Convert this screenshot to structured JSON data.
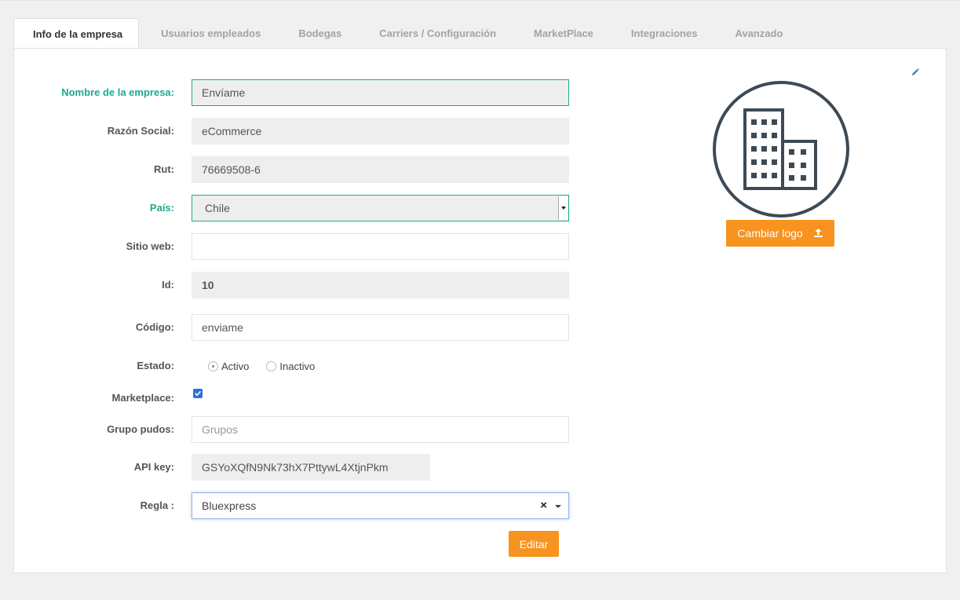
{
  "tabs": [
    {
      "label": "Info de la empresa",
      "active": true
    },
    {
      "label": "Usuarios empleados"
    },
    {
      "label": "Bodegas"
    },
    {
      "label": "Carriers / Configuración"
    },
    {
      "label": "MarketPlace"
    },
    {
      "label": "Integraciones"
    },
    {
      "label": "Avanzado"
    }
  ],
  "form": {
    "company_name_label": "Nombre de la empresa:",
    "company_name": "Envíame",
    "razon_social_label": "Razón Social:",
    "razon_social": "eCommerce",
    "rut_label": "Rut:",
    "rut": "76669508-6",
    "pais_label": "País:",
    "pais": "Chile",
    "sitio_web_label": "Sitio web:",
    "sitio_web": "",
    "id_label": "Id:",
    "id": "10",
    "codigo_label": "Código:",
    "codigo": "enviame",
    "estado_label": "Estado:",
    "estado_activo": "Activo",
    "estado_inactivo": "Inactivo",
    "marketplace_label": "Marketplace:",
    "marketplace_checked": true,
    "grupo_pudos_label": "Grupo pudos:",
    "grupo_pudos_placeholder": "Grupos",
    "api_key_label": "API key:",
    "api_key": "GSYoXQfN9Nk73hX7PttywL4XtjnPkm",
    "regla_label": "Regla :",
    "regla": "Bluexpress",
    "regla_clear": "×",
    "editar_button": "Editar"
  },
  "logo": {
    "change_logo_button": "Cambiar logo",
    "icon": "building-icon"
  },
  "colors": {
    "accent_green": "#1dab8a",
    "orange": "#f7931e",
    "checkbox_blue": "#2f6fd8",
    "logo_gray": "#3d4a55"
  }
}
